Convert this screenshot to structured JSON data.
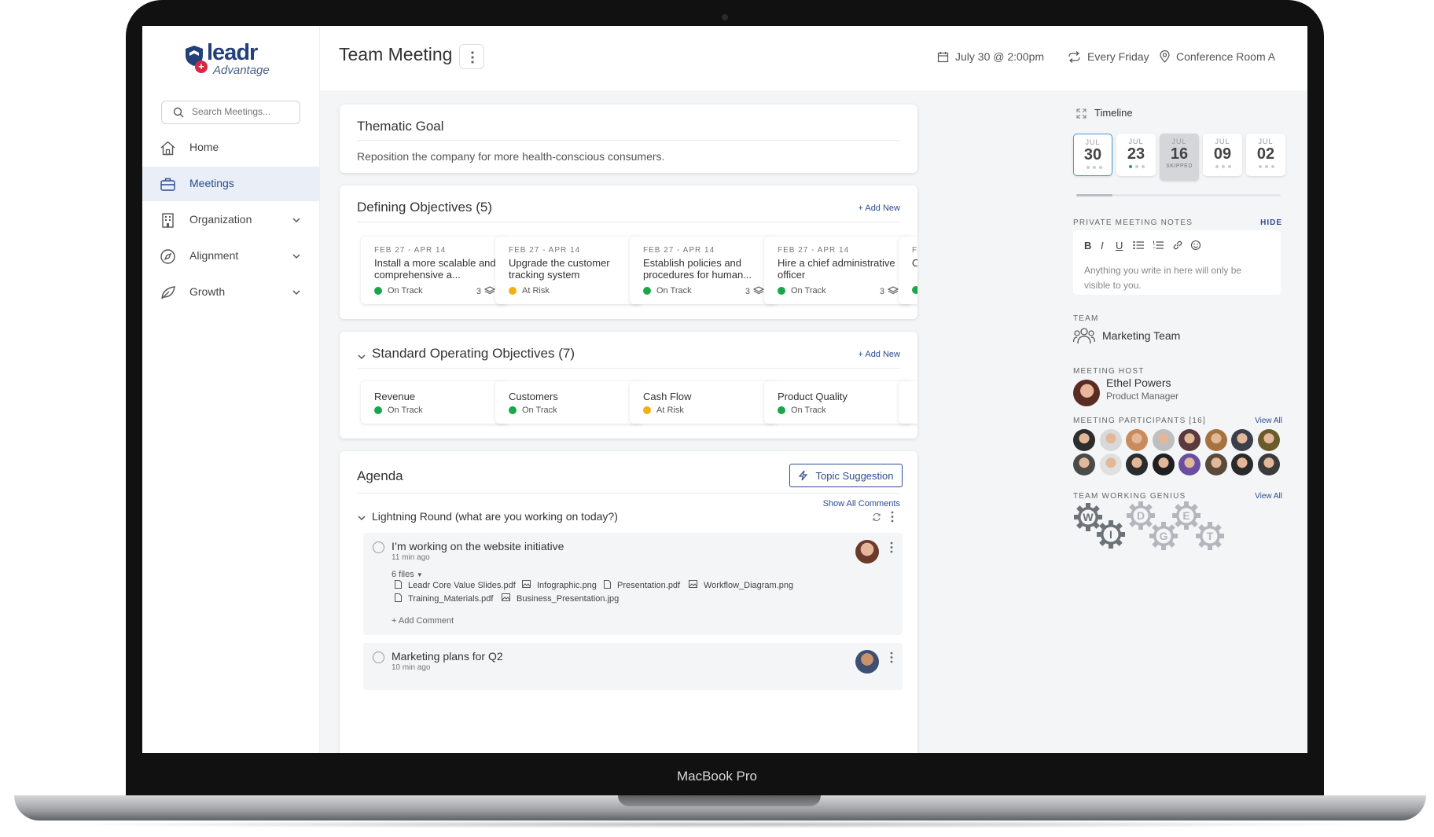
{
  "device": {
    "label": "MacBook Pro"
  },
  "brand": {
    "name": "leadr",
    "tagline": "Advantage",
    "badge": "+"
  },
  "search": {
    "placeholder": "Search Meetings..."
  },
  "nav": [
    {
      "label": "Home",
      "icon": "home-icon",
      "active": false
    },
    {
      "label": "Meetings",
      "icon": "briefcase-icon",
      "active": true
    },
    {
      "label": "Organization",
      "icon": "building-icon",
      "active": false,
      "expandable": true
    },
    {
      "label": "Alignment",
      "icon": "compass-icon",
      "active": false,
      "expandable": true
    },
    {
      "label": "Growth",
      "icon": "leaf-icon",
      "active": false,
      "expandable": true
    }
  ],
  "header": {
    "title": "Team Meeting",
    "date": "July 30 @ 2:00pm",
    "recurrence": "Every Friday",
    "location": "Conference Room A"
  },
  "thematic_goal": {
    "title": "Thematic Goal",
    "text": "Reposition the company for more health-conscious consumers."
  },
  "defining_objectives": {
    "title": "Defining Objectives",
    "count": "(5)",
    "add_label": "+ Add New",
    "items": [
      {
        "date": "FEB 27 - APR 14",
        "title": "Install a more scalable and comprehensive a...",
        "status": "On Track",
        "status_color": "#1aa64b",
        "count": "3"
      },
      {
        "date": "FEB 27 - APR 14",
        "title": "Upgrade the customer tracking system",
        "status": "At Risk",
        "status_color": "#f2b112",
        "count": ""
      },
      {
        "date": "FEB 27 - APR 14",
        "title": "Establish policies and procedures for human...",
        "status": "On Track",
        "status_color": "#1aa64b",
        "count": "3"
      },
      {
        "date": "FEB 27 - APR 14",
        "title": "Hire a chief administrative officer",
        "status": "On Track",
        "status_color": "#1aa64b",
        "count": "3"
      },
      {
        "date": "FE",
        "title": "O",
        "status": "",
        "status_color": "#1aa64b",
        "count": ""
      }
    ]
  },
  "standard_objectives": {
    "title": "Standard Operating Objectives",
    "count": "(7)",
    "add_label": "+ Add New",
    "items": [
      {
        "title": "Revenue",
        "status": "On Track",
        "status_color": "#1aa64b"
      },
      {
        "title": "Customers",
        "status": "On Track",
        "status_color": "#1aa64b"
      },
      {
        "title": "Cash Flow",
        "status": "At Risk",
        "status_color": "#f2b112"
      },
      {
        "title": "Product Quality",
        "status": "On Track",
        "status_color": "#1aa64b"
      }
    ]
  },
  "agenda": {
    "title": "Agenda",
    "topic_button": "Topic Suggestion",
    "show_comments": "Show All Comments",
    "section": "Lightning Round (what are you working on today?)",
    "items": [
      {
        "title": "I’m working on the website initiative",
        "time": "11 min ago",
        "files_label": "6 files",
        "files": [
          "Leadr Core Value Slides.pdf",
          "Infographic.png",
          "Presentation.pdf",
          "Workflow_Diagram.png",
          "Training_Materials.pdf",
          "Business_Presentation.jpg"
        ],
        "add_comment": "+ Add Comment"
      },
      {
        "title": "Marketing plans for Q2",
        "time": "10 min ago"
      }
    ]
  },
  "timeline": {
    "title": "Timeline",
    "dates": [
      {
        "month": "JUL",
        "day": "30",
        "note": "",
        "selected": true
      },
      {
        "month": "JUL",
        "day": "23",
        "note": ""
      },
      {
        "month": "JUL",
        "day": "16",
        "note": "SKIPPED"
      },
      {
        "month": "JUL",
        "day": "09",
        "note": ""
      },
      {
        "month": "JUL",
        "day": "02",
        "note": ""
      }
    ]
  },
  "notes": {
    "label": "PRIVATE MEETING NOTES",
    "hide": "HIDE",
    "placeholder": "Anything you write in here will only be visible to you.",
    "toolbar": [
      "B",
      "I",
      "U",
      "bullet-list-icon",
      "numbered-list-icon",
      "link-icon",
      "emoji-icon"
    ]
  },
  "team": {
    "label": "TEAM",
    "name": "Marketing Team"
  },
  "host": {
    "label": "MEETING HOST",
    "name": "Ethel Powers",
    "role": "Product Manager"
  },
  "participants": {
    "label": "MEETING PARTICIPANTS [16]",
    "view_all": "View All",
    "colors": [
      "#2d2d2d",
      "#d9d9d9",
      "#c98b5c",
      "#bfbfbf",
      "#5a3a3a",
      "#a6733f",
      "#3a3f4a",
      "#6b5b2a",
      "#4a4a4a",
      "#e0e0e0",
      "#2c2c2c",
      "#1f1f1f",
      "#6a4fa0",
      "#5b4a3a",
      "#2a2a2a",
      "#3b3b3b"
    ]
  },
  "genius": {
    "label": "TEAM WORKING GENIUS",
    "view_all": "View All",
    "letters": [
      "W",
      "I",
      "D",
      "G",
      "E",
      "T"
    ]
  },
  "colors": {
    "accent": "#2b4c8e",
    "on_track": "#1aa64b",
    "at_risk": "#f2b112",
    "selected_chip": "#4d9ad3"
  }
}
